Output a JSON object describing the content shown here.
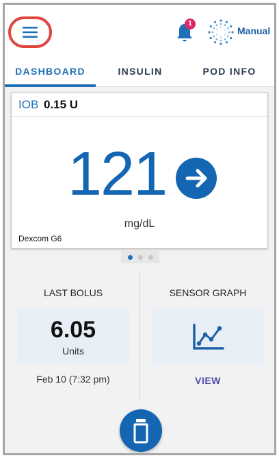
{
  "header": {
    "notification_count": "1",
    "mode_label": "Manual"
  },
  "tabs": [
    {
      "label": "DASHBOARD",
      "active": true
    },
    {
      "label": "INSULIN",
      "active": false
    },
    {
      "label": "POD INFO",
      "active": false
    }
  ],
  "glucose_card": {
    "iob_label": "IOB",
    "iob_value": "0.15 U",
    "glucose_value": "121",
    "unit": "mg/dL",
    "source": "Dexcom G6",
    "trend_icon": "arrow-right-icon"
  },
  "pager": {
    "pages": 3,
    "active_index": 0
  },
  "last_bolus": {
    "title": "LAST BOLUS",
    "value": "6.05",
    "unit": "Units",
    "time": "Feb 10 (7:32 pm)"
  },
  "sensor_graph": {
    "title": "SENSOR GRAPH",
    "link_label": "VIEW",
    "icon": "line-chart-icon"
  },
  "colors": {
    "brand_blue": "#1466b3",
    "tab_active": "#1f6fb6",
    "badge": "#e0256a",
    "highlight_ring": "#e0463e",
    "link_purple": "#4b4ea8"
  }
}
